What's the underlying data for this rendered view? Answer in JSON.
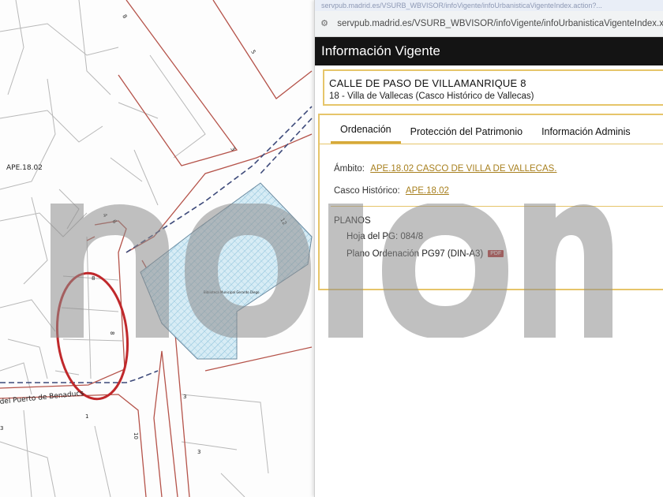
{
  "map": {
    "zone_label": "APE.18.02",
    "street_label": "del Puerto de Benaducs",
    "building_label": "Biblioteca Municipal Gerardo Diego",
    "numbers": [
      "8",
      "5",
      "3",
      "1",
      "3",
      "10",
      "4",
      "6",
      "8",
      "12",
      "3",
      "3",
      "8"
    ]
  },
  "popup": {
    "titlebar_text": "servpub.madrid.es/VSURB_WBVISOR/infoVigente/infoUrbanisticaVigenteIndex.action?...",
    "url": "servpub.madrid.es/VSURB_WBVISOR/infoVigente/infoUrbanisticaVigenteIndex.x",
    "header_title": "Información Vigente",
    "address": {
      "street": "CALLE DE PASO DE VILLAMANRIQUE 8",
      "district": "18 - Villa de Vallecas (Casco Histórico de Vallecas)"
    },
    "tabs": [
      {
        "label": "Ordenación",
        "active": true
      },
      {
        "label": "Protección del Patrimonio",
        "active": false
      },
      {
        "label": "Información Adminis",
        "active": false
      }
    ],
    "ambito": {
      "label": "Ámbito:",
      "value": "APE.18.02 CASCO DE VILLA DE VALLECAS."
    },
    "casco": {
      "label": "Casco Histórico:",
      "value": "APE.18.02"
    },
    "planos": {
      "title": "PLANOS",
      "hoja": "Hoja del PG: 084/8",
      "plano": "Plano Ordenación PG97 (DIN-A3)",
      "pdf_badge": "PDF"
    }
  },
  "watermark": {
    "text": "nolon",
    "color": "#8c8c8c"
  },
  "colors": {
    "accent_gold": "#e6c56a",
    "link_gold": "#a8801f",
    "header_bg": "#141414",
    "map_red": "#b5534a",
    "highlight_circle": "#c0282b",
    "hatch_blue": "#6fb7d6"
  }
}
